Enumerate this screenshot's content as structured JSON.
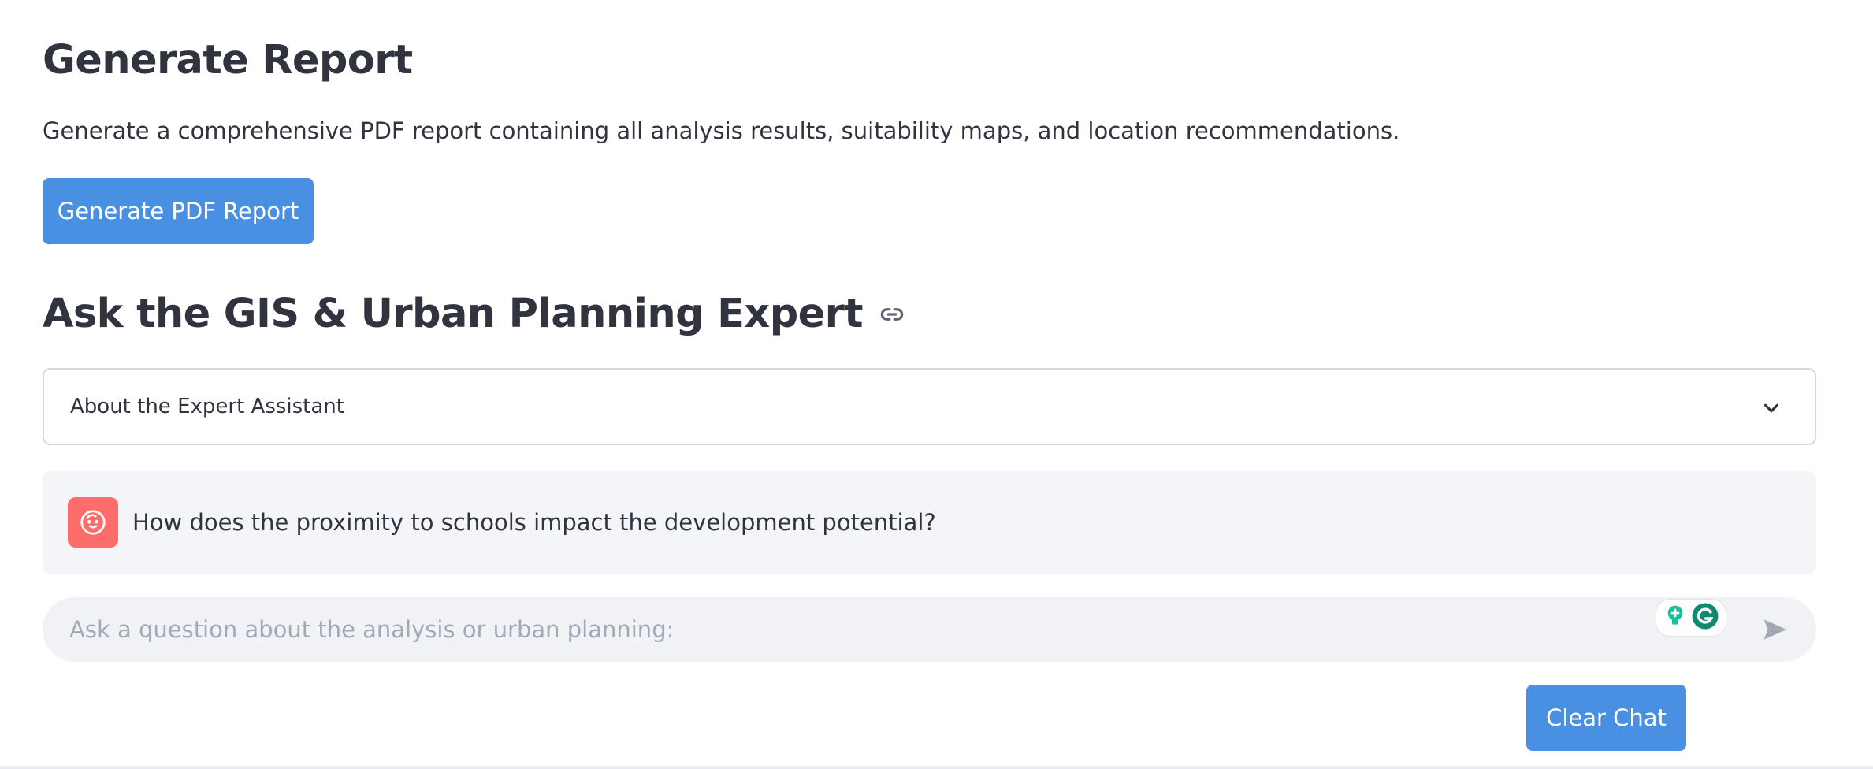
{
  "report": {
    "title": "Generate Report",
    "description": "Generate a comprehensive PDF report containing all analysis results, suitability maps, and location recommendations.",
    "button_label": "Generate PDF Report"
  },
  "expert": {
    "title": "Ask the GIS & Urban Planning Expert",
    "link_icon": "link-icon",
    "expander_label": "About the Expert Assistant"
  },
  "chat": {
    "messages": [
      {
        "role": "user",
        "avatar_icon": "user-face-icon",
        "text": "How does the proximity to schools impact the development potential?"
      }
    ],
    "input_placeholder": "Ask a question about the analysis or urban planning:",
    "input_value": "",
    "clear_label": "Clear Chat"
  },
  "colors": {
    "primary": "#4a90e2",
    "avatar": "#ff6c6c",
    "text": "#31333f",
    "grammarly": "#15c39a"
  }
}
